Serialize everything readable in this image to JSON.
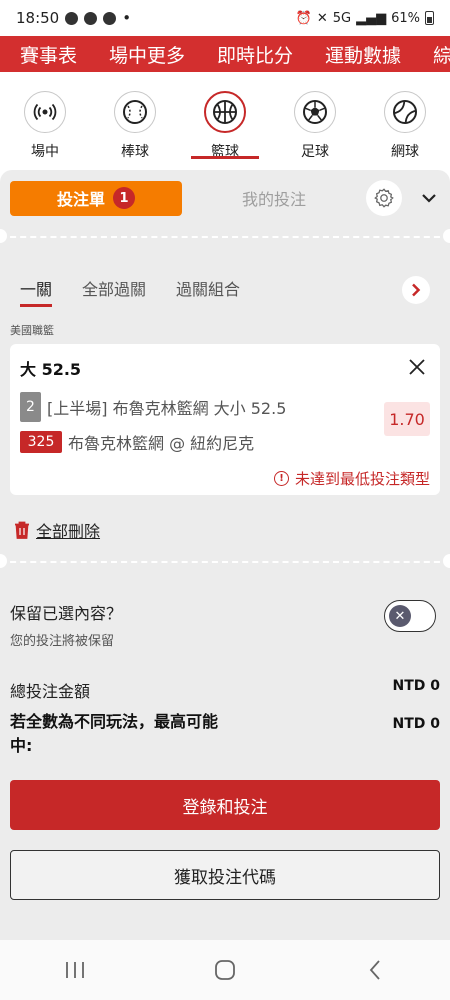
{
  "status_bar": {
    "time": "18:50",
    "dot": "•",
    "network": "5G",
    "battery": "61%"
  },
  "top_tabs": [
    "賽事表",
    "場中更多",
    "即時比分",
    "運動數據",
    "綜"
  ],
  "sports": [
    {
      "label": "場中",
      "icon": "live-broadcast-icon",
      "active": false
    },
    {
      "label": "棒球",
      "icon": "baseball-icon",
      "active": false
    },
    {
      "label": "籃球",
      "icon": "basketball-icon",
      "active": true
    },
    {
      "label": "足球",
      "icon": "soccer-ball-icon",
      "active": false
    },
    {
      "label": "網球",
      "icon": "tennis-ball-icon",
      "active": false
    }
  ],
  "slip": {
    "betslip_label": "投注單",
    "betslip_count": "1",
    "my_bets_label": "我的投注",
    "type_tabs": [
      "一關",
      "全部過關",
      "過關組合"
    ],
    "league": "美國職籃",
    "selection": {
      "title": "大 52.5",
      "period": "2",
      "market": "[上半場] 布魯克林籃網 大小 52.5",
      "odds": "1.70",
      "event_id": "325",
      "match": "布魯克林籃網 @ 紐約尼克",
      "warning": "未達到最低投注類型"
    },
    "delete_all": "全部刪除",
    "keep_title": "保留已選內容？",
    "keep_sub": "您的投注將被保留",
    "total_label": "總投注金額",
    "total_value": "NTD 0",
    "max_label": "若全數為不同玩法，最高可能中:",
    "max_value": "NTD 0",
    "login_button": "登錄和投注",
    "code_button": "獲取投注代碼"
  },
  "colors": {
    "brand_red": "#d32f2f",
    "accent_orange": "#f57c00",
    "odds_bg": "#fbe3e3"
  }
}
